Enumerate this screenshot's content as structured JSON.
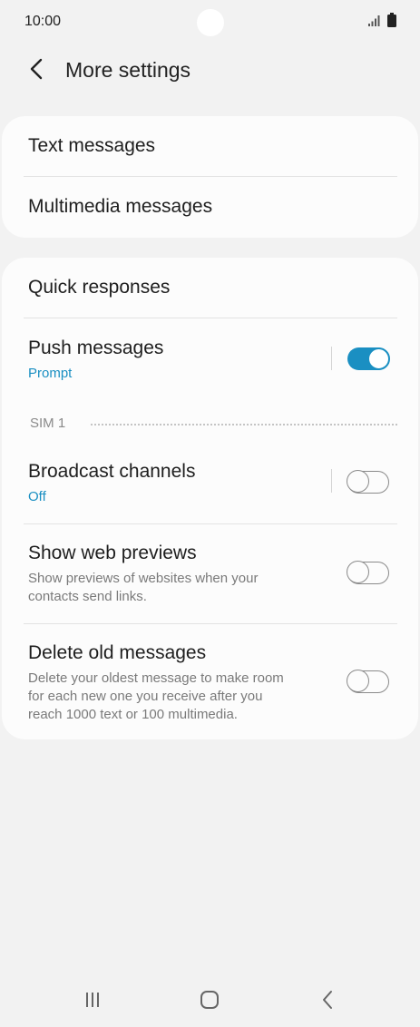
{
  "status_bar": {
    "time": "10:00"
  },
  "header": {
    "title": "More settings"
  },
  "card1": {
    "text_messages": "Text messages",
    "multimedia_messages": "Multimedia messages"
  },
  "card2": {
    "quick_responses": "Quick responses",
    "push_messages": {
      "title": "Push messages",
      "subtitle": "Prompt",
      "enabled": true
    },
    "section_label": "SIM 1",
    "broadcast_channels": {
      "title": "Broadcast channels",
      "subtitle": "Off",
      "enabled": false
    },
    "show_web_previews": {
      "title": "Show web previews",
      "desc_line1": "Show previews of websites when your",
      "desc_line2": "contacts send links.",
      "enabled": false
    },
    "delete_old_messages": {
      "title": "Delete old messages",
      "desc_line1": "Delete your oldest message to make room",
      "desc_line2": "for each new one you receive after you",
      "desc_line3": "reach 1000 text or 100 multimedia.",
      "enabled": false
    }
  },
  "colors": {
    "accent": "#1a8fc2",
    "background": "#f2f2f2",
    "card": "#fcfcfc"
  },
  "icons": {
    "back": "chevron-left-icon",
    "recents": "recent-apps-icon",
    "home": "home-icon",
    "nav_back": "nav-back-icon"
  }
}
